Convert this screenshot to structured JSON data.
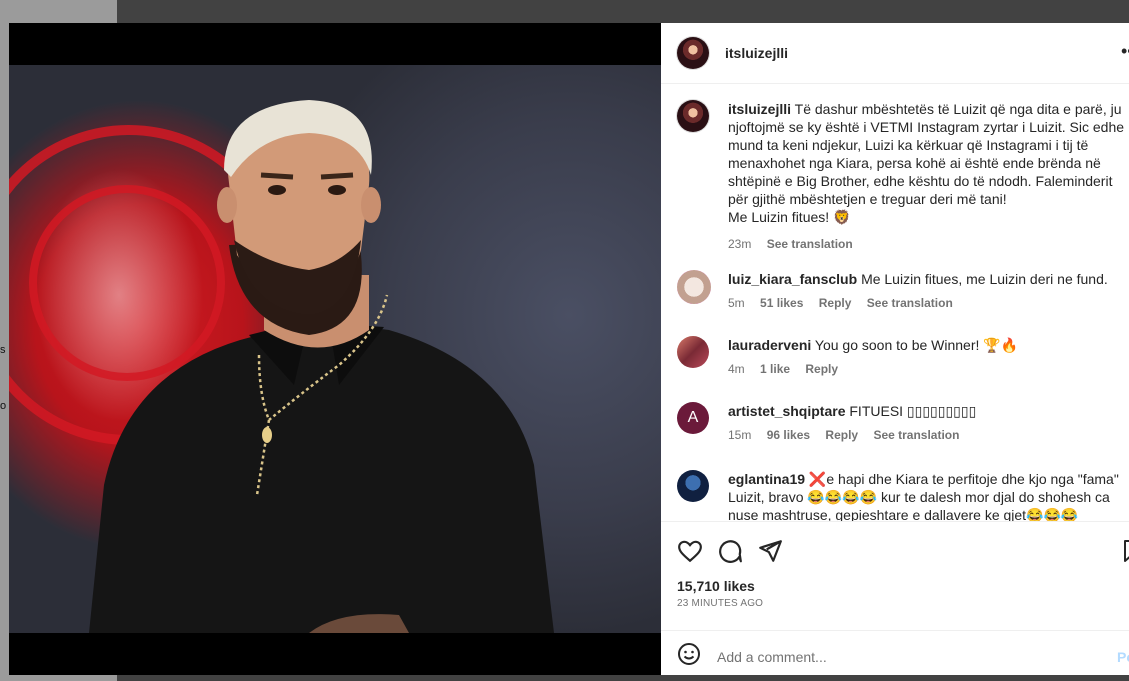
{
  "background": {
    "frag_1": "s",
    "frag_2": "o"
  },
  "post": {
    "username": "itsluizejlli",
    "caption": "Të dashur mbështetës të Luizit që nga dita e parë, ju njoftojmë se ky është i VETMI Instagram zyrtar i Luizit. Sic edhe mund ta keni ndjekur, Luizi ka kërkuar që Instagrami i tij të menaxhohet nga Kiara, persa kohë ai është ende brënda në shtëpinë e Big Brother, edhe kështu do të ndodh. Faleminderit për gjithë mbështetjen e treguar deri më tani!",
    "caption_line2": "Me Luizin fitues! 🦁",
    "time": "23m",
    "see_translation": "See translation"
  },
  "comments": [
    {
      "username": "luiz_kiara_fansclub",
      "text": "Me Luizin fitues, me Luizin deri ne fund.",
      "time": "5m",
      "likes": "51 likes",
      "reply": "Reply",
      "translation": "See translation"
    },
    {
      "username": "lauraderveni",
      "text": "You go soon to be Winner! 🏆🔥",
      "time": "4m",
      "likes": "1 like",
      "reply": "Reply",
      "translation": ""
    },
    {
      "username": "artistet_shqiptare",
      "text": "FITUESI ▯▯▯▯▯▯▯▯▯",
      "time": "15m",
      "likes": "96 likes",
      "reply": "Reply",
      "translation": "See translation"
    },
    {
      "username": "eglantina19",
      "text": "❌e hapi dhe Kiara te perfitoje dhe kjo nga \"fama\" Luizit, bravo 😂😂😂😂 kur te dalesh mor djal do shohesh ca nuse mashtruse, gepieshtare e dallavere ke gjet😂😂😂",
      "time": "",
      "likes": "",
      "reply": "",
      "translation": ""
    }
  ],
  "footer": {
    "likes": "15,710 likes",
    "ago": "23 MINUTES AGO",
    "add_comment_placeholder": "Add a comment...",
    "post_button": "Po"
  },
  "icons": [
    "heart-icon",
    "comment-icon",
    "share-icon",
    "save-icon",
    "emoji-icon",
    "more-icon"
  ]
}
